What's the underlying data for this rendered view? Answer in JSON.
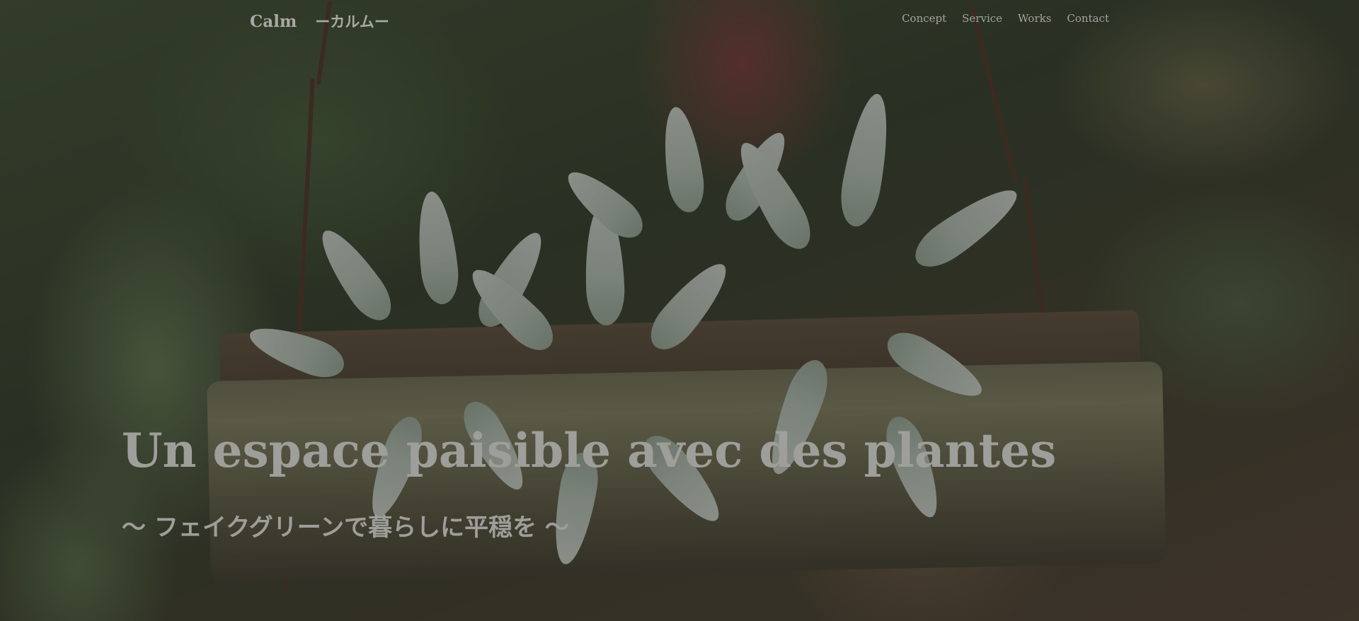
{
  "header": {
    "logo": "Calm",
    "logo_sub": "ーカルムー",
    "nav": [
      "Concept",
      "Service",
      "Works",
      "Contact"
    ]
  },
  "hero": {
    "headline": "Un espace paisible avec des plantes",
    "subline": "〜 フェイクグリーンで暮らしに平穏を 〜"
  },
  "colors": {
    "overlay": "#141414",
    "text": "#9e9e9a"
  }
}
